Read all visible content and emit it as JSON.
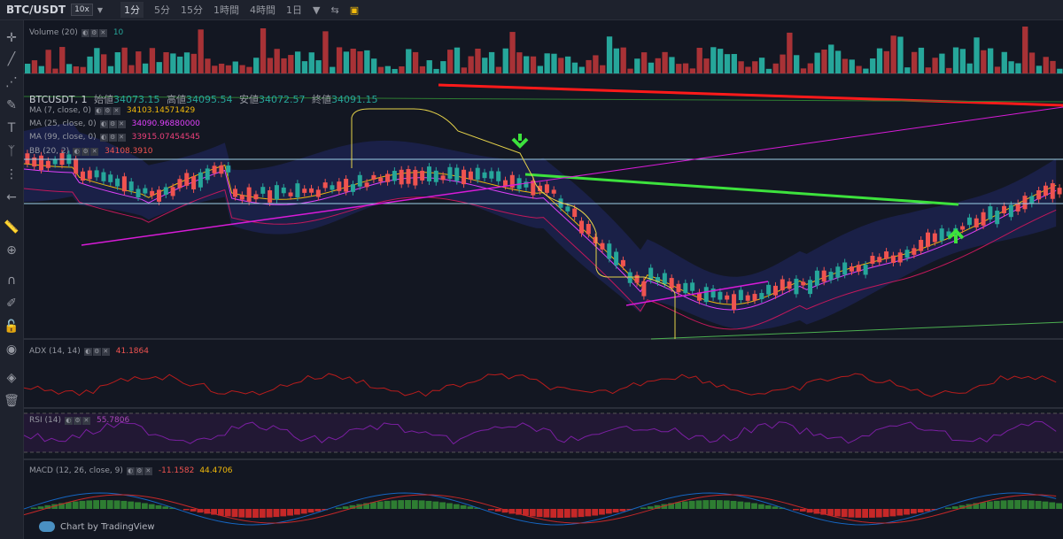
{
  "toolbar": {
    "symbol": "BTC/USDT",
    "leverage": "10x",
    "timeframes": [
      "1分",
      "5分",
      "15分",
      "1時間",
      "4時間",
      "1日"
    ],
    "active_timeframe": "1分"
  },
  "main": {
    "symbol_label": "BTCUSDT, 1",
    "open_label": "始値",
    "open_value": "34073.15",
    "high_label": "高値",
    "high_value": "34095.54",
    "low_label": "安値",
    "low_value": "34072.57",
    "close_label": "終値",
    "close_value": "34091.15"
  },
  "indicators": {
    "volume": {
      "label": "Volume (20)",
      "value": "10"
    },
    "ma7": {
      "label": "MA (7, close, 0)",
      "value": "34103.14571429",
      "color": "#f0b90b"
    },
    "ma25": {
      "label": "MA (25, close, 0)",
      "value": "34090.96880000",
      "color": "#e040fb"
    },
    "ma99": {
      "label": "MA (99, close, 0)",
      "value": "33915.07454545",
      "color": "#c2185b"
    },
    "bb": {
      "label": "BB (20, 2)",
      "value": "34108.3910"
    },
    "adx": {
      "label": "ADX (14, 14)",
      "value": "41.1864"
    },
    "rsi": {
      "label": "RSI (14)",
      "value": "55.7806"
    },
    "macd": {
      "label": "MACD (12, 26, close, 9)",
      "value1": "-11.1582",
      "value2": "44.4706"
    }
  },
  "footer": {
    "brand": "Chart by TradingView"
  },
  "colors": {
    "up": "#26a69a",
    "down": "#ef5350",
    "bg": "#131722",
    "accent_yellow": "#f0b90b"
  }
}
